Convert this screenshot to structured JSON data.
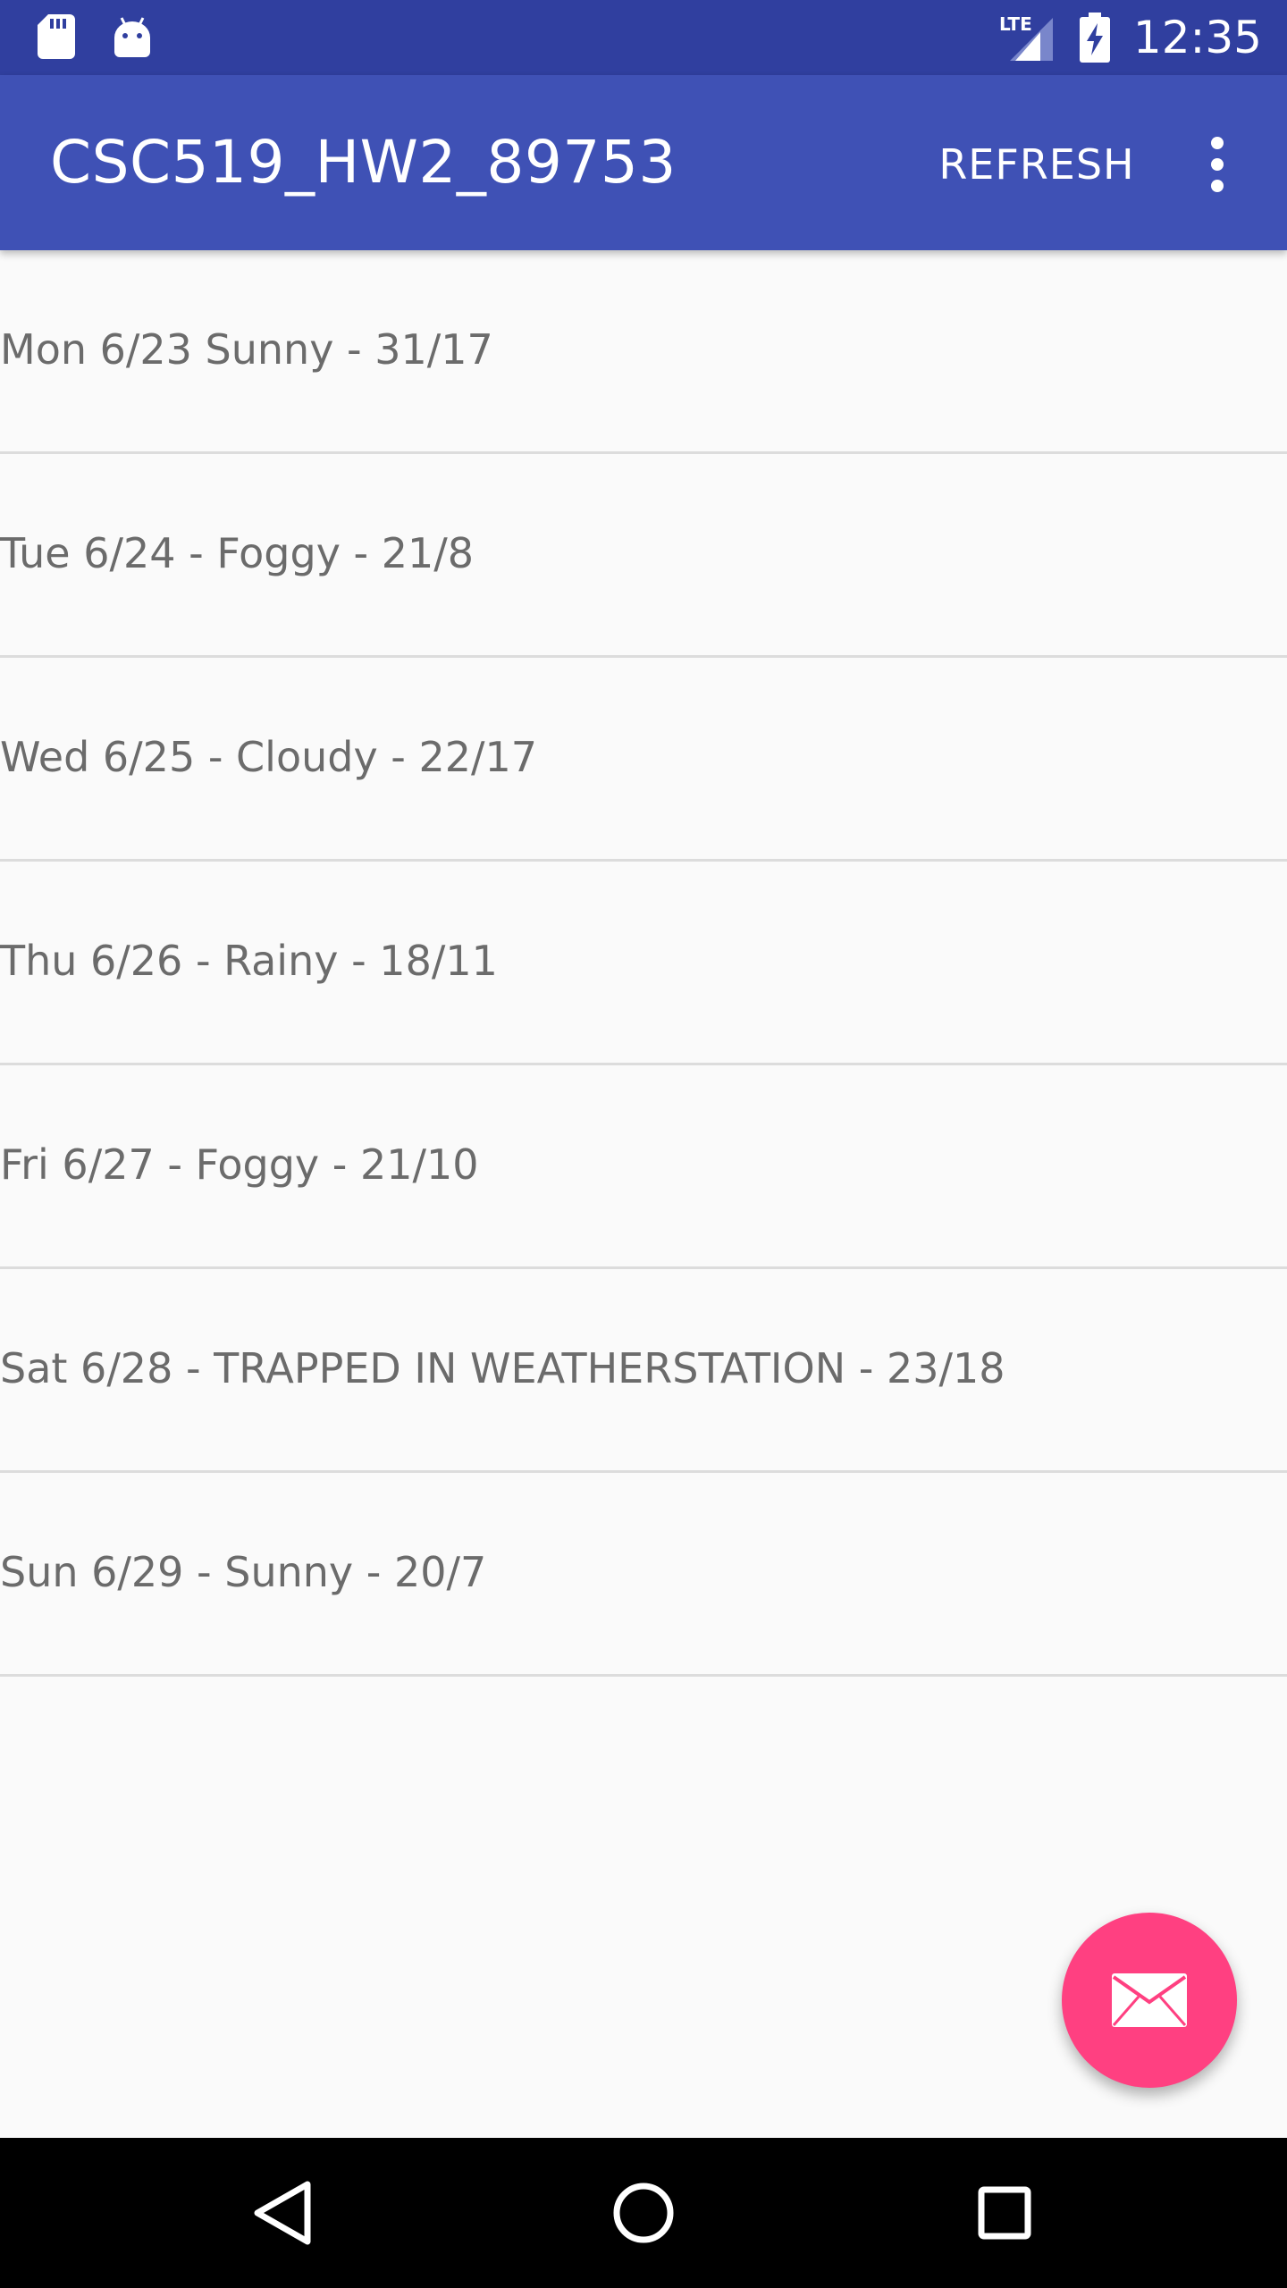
{
  "status_bar": {
    "time": "12:35",
    "network_label": "LTE",
    "icons": [
      "sd-card-icon",
      "android-icon",
      "signal-icon",
      "battery-charging-icon"
    ]
  },
  "app_bar": {
    "title": "CSC519_HW2_89753",
    "refresh_label": "REFRESH",
    "overflow_icon": "more-vert-icon"
  },
  "forecast": [
    "Mon 6/23 Sunny - 31/17",
    "Tue 6/24 - Foggy - 21/8",
    "Wed 6/25 - Cloudy - 22/17",
    "Thu 6/26 - Rainy - 18/11",
    "Fri 6/27 - Foggy - 21/10",
    "Sat 6/28 - TRAPPED IN WEATHERSTATION - 23/18",
    "Sun 6/29 - Sunny - 20/7"
  ],
  "fab": {
    "icon": "email-icon"
  },
  "nav_bar": {
    "icons": [
      "back-icon",
      "home-icon",
      "recents-icon"
    ]
  },
  "colors": {
    "status_bar": "#303f9f",
    "app_bar": "#3f51b5",
    "accent": "#ff4081",
    "list_text": "#6b6b6b",
    "divider": "#dcdcdc",
    "background": "#fafafa"
  }
}
